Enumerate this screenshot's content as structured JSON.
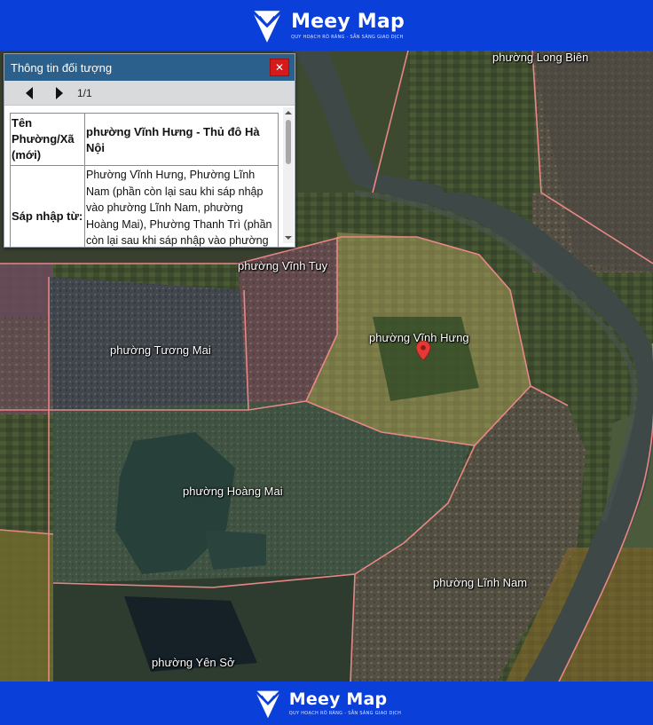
{
  "brand": {
    "name": "Meey Map",
    "tagline": "QUY HOẠCH RÕ RÀNG - SẴN SÀNG GIAO DỊCH"
  },
  "map": {
    "labels": {
      "long_bien": "phường Long Biên",
      "vinh_tuy": "phường Vĩnh Tuy",
      "tuong_mai": "phường Tương Mai",
      "vinh_hung": "phường Vĩnh Hưng",
      "hoang_mai": "phường Hoàng Mai",
      "linh_nam": "phường Lĩnh Nam",
      "yen_so": "phường Yên Sở"
    },
    "colors": {
      "boundary": "#f08a8a",
      "selected_fill": "#e7d07a",
      "pin": "#e53935"
    }
  },
  "info_panel": {
    "title": "Thông tin đối tượng",
    "close_icon": "close-icon",
    "pager": {
      "count": "1/1"
    },
    "rows": [
      {
        "key": "Tên Phường/Xã (mới)",
        "value": "phường Vĩnh Hưng - Thủ đô Hà Nội"
      },
      {
        "key": "Sáp nhập từ:",
        "value": "Phường Vĩnh Hưng, Phường Lĩnh Nam (phần còn lại sau khi sáp nhập vào phường Lĩnh Nam, phường Hoàng Mai), Phường Thanh Trì (phần còn lại sau khi sáp nhập vào phường Lĩnh"
      }
    ]
  }
}
